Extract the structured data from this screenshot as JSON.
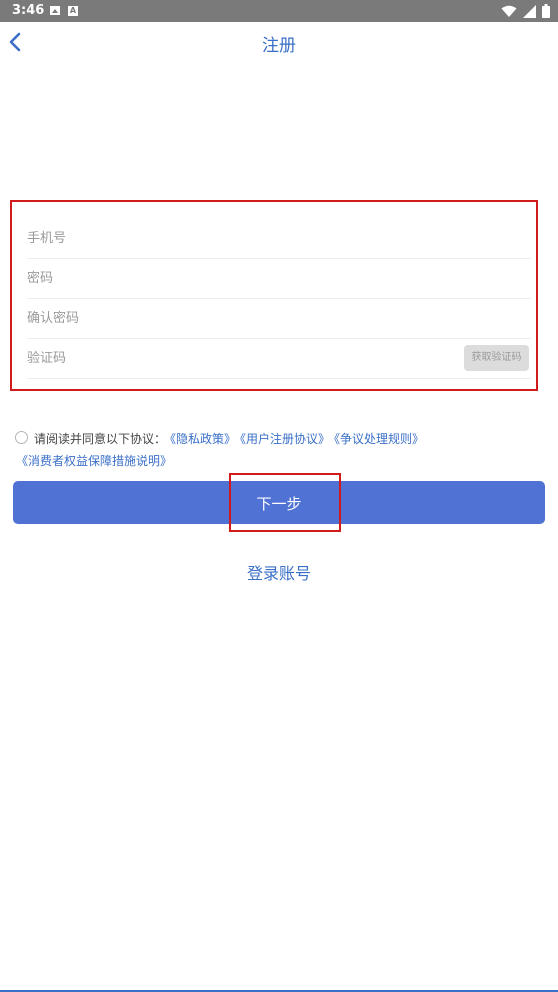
{
  "status_bar": {
    "time": "3:46",
    "icons": [
      "image-icon",
      "a-icon",
      "wifi-icon",
      "signal-icon",
      "battery-icon"
    ]
  },
  "header": {
    "title": "注册",
    "back_icon": "chevron-left-icon"
  },
  "form": {
    "phone_placeholder": "手机号",
    "password_placeholder": "密码",
    "confirm_placeholder": "确认密码",
    "code_placeholder": "验证码",
    "get_code_label": "获取验证码"
  },
  "agreement": {
    "text": "请阅读并同意以下协议：",
    "links": [
      "《隐私政策》",
      "《用户注册协议》",
      "《争议处理规则》",
      "《消费者权益保障措施说明》"
    ]
  },
  "next_button": {
    "label": "下一步"
  },
  "login_link": {
    "label": "登录账号"
  },
  "colors": {
    "accent": "#4f72d4",
    "link": "#3a6fc8",
    "highlight": "#d11b1b",
    "status_bar": "#7a7a7a"
  }
}
